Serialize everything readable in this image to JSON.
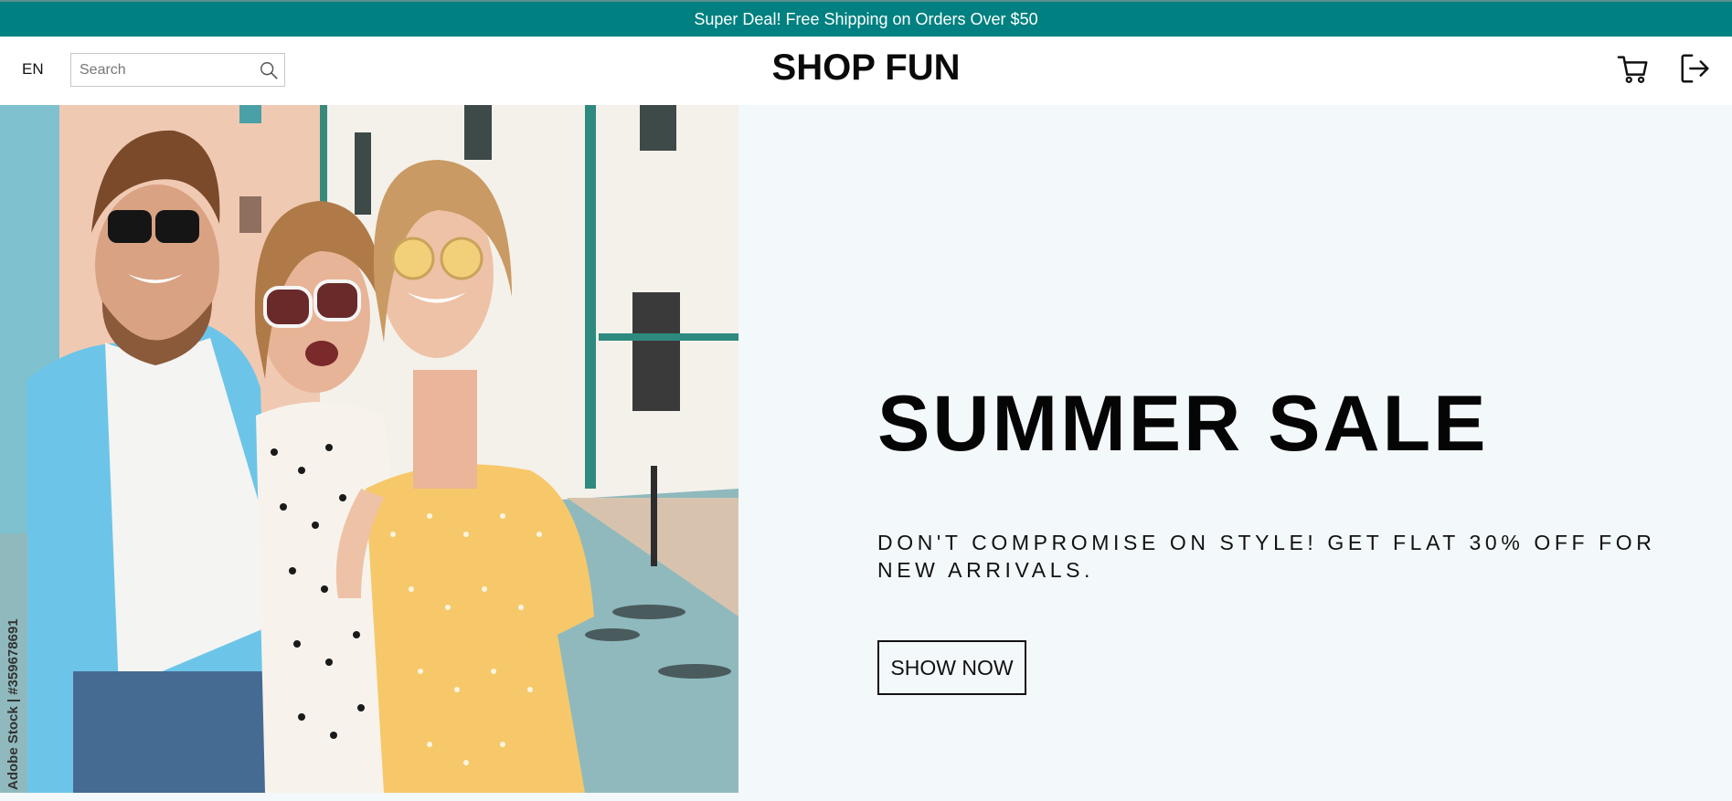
{
  "announcement": {
    "text": "Super Deal! Free Shipping on Orders Over $50"
  },
  "navbar": {
    "language": "EN",
    "search": {
      "placeholder": "Search",
      "value": "",
      "icon": "search-icon"
    },
    "brand": "SHOP FUN",
    "icons": [
      "cart-icon",
      "logout-icon"
    ]
  },
  "hero": {
    "image_watermark": "Adobe Stock | #359678691",
    "title": "SUMMER SALE",
    "description": "DON'T COMPROMISE ON STYLE! GET FLAT 30% OFF FOR NEW ARRIVALS.",
    "button_label": "SHOW NOW"
  },
  "colors": {
    "accent": "#008080",
    "hero_background": "#f3f8fb",
    "text": "#111111"
  }
}
